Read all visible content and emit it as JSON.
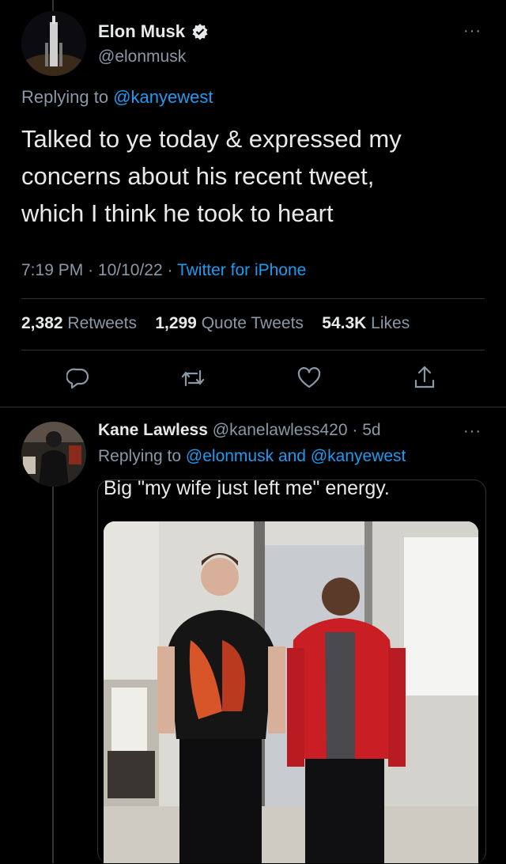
{
  "main_tweet": {
    "display_name": "Elon Musk",
    "handle": "@elonmusk",
    "replying_prefix": "Replying to",
    "replying_to": "@kanyewest",
    "text_lines": [
      "Talked to ye today & expressed my",
      "concerns about his recent tweet,",
      "which I think he took to heart"
    ],
    "time": "7:19 PM",
    "date": "10/10/22",
    "source": "Twitter for iPhone",
    "stats": {
      "retweets_count": "2,382",
      "retweets_label": "Retweets",
      "quotes_count": "1,299",
      "quotes_label": "Quote Tweets",
      "likes_count": "54.3K",
      "likes_label": "Likes"
    },
    "more": "···"
  },
  "reply_tweet": {
    "display_name": "Kane Lawless",
    "handle": "@kanelawless420",
    "age": "5d",
    "replying_prefix": "Replying to",
    "replying_to_1": "@elonmusk",
    "and": "and",
    "replying_to_2": "@kanyewest",
    "caption": "Big \"my wife just left me\" energy.",
    "more": "···"
  },
  "icons": [
    "verified-badge-icon",
    "reply-icon",
    "retweet-icon",
    "like-icon",
    "share-icon",
    "more-icon"
  ],
  "colors": {
    "background": "#000000",
    "text": "#e7e9ea",
    "secondary": "#8b98a5",
    "link": "#1d9bf0",
    "divider": "#2f3336"
  }
}
